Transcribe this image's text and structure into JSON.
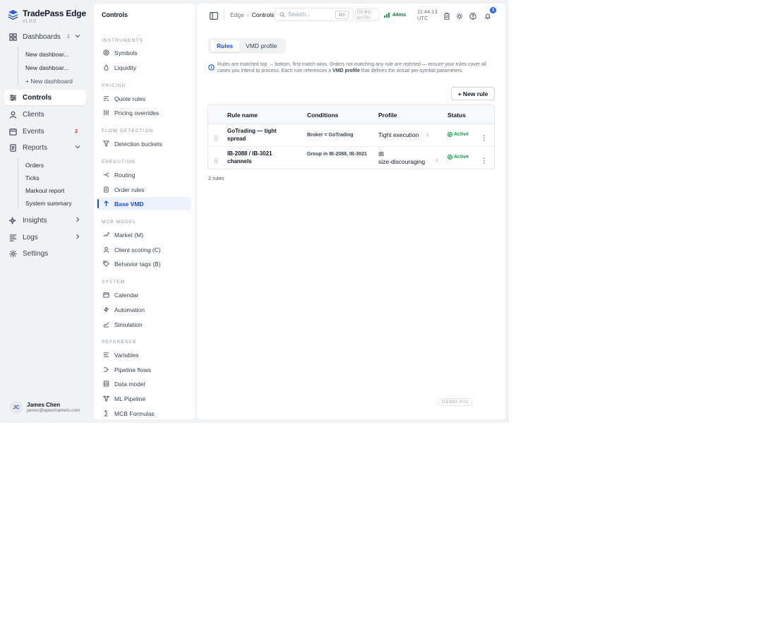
{
  "brand": {
    "name": "TradePass Edge",
    "version": "v1.0.0"
  },
  "sidebar": {
    "dashboards": {
      "label": "Dashboards",
      "count": "2"
    },
    "dashboard_items": [
      "New dashboar...",
      "New dashboar..."
    ],
    "new_dashboard": "+ New dashboard",
    "controls": "Controls",
    "clients": "Clients",
    "events": {
      "label": "Events",
      "count": "2"
    },
    "reports": "Reports",
    "report_items": [
      "Orders",
      "Ticks",
      "Markout report",
      "System summary"
    ],
    "insights": "Insights",
    "logs": "Logs",
    "settings": "Settings"
  },
  "user": {
    "initials": "JC",
    "name": "James Chen",
    "email": "james@apexmarkets.com"
  },
  "panel": {
    "title": "Controls",
    "groups": {
      "instruments": "INSTRUMENTS",
      "pricing": "PRICING",
      "flow_detection": "FLOW DETECTION",
      "execution": "EXECUTION",
      "mcb_model": "MCB MODEL",
      "system": "SYSTEM",
      "reference": "REFERENCE"
    },
    "items": {
      "symbols": "Symbols",
      "liquidity": "Liquidity",
      "quote_rules": "Quote rules",
      "pricing_overrides": "Pricing overrides",
      "detection_buckets": "Detection buckets",
      "routing": "Routing",
      "order_rules": "Order rules",
      "base_vmd": "Base VMD",
      "market": "Market (M)",
      "client_scoring": "Client scoring (C)",
      "behavior_tags": "Behavior tags (B)",
      "calendar": "Calendar",
      "automation": "Automation",
      "simulation": "Simulation",
      "variables": "Variables",
      "pipeline_flows": "Pipeline flows",
      "data_model": "Data model",
      "ml_pipeline": "ML Pipeline",
      "mcb_formulas": "MCB Formulas"
    }
  },
  "topbar": {
    "crumb_root": "Edge",
    "crumb_sep": "›",
    "crumb_current": "Controls",
    "search_placeholder": "Search...",
    "search_shortcut": "⌘K",
    "demo_line1": "DEMO ·",
    "demo_line2": "AUTO",
    "latency": "44ms",
    "time": "11:44:13",
    "timezone": "UTC",
    "notifications": "3"
  },
  "tabs": {
    "rules": "Rules",
    "vmd_profile": "VMD profile"
  },
  "info": {
    "part1": "Rules are matched top → bottom, first match wins. Orders not matching any rule are rejected — ensure your rules cover all cases you intend to process. Each rule references a ",
    "bold": "VMD profile",
    "part2": " that defines the actual per‑symbol parameters."
  },
  "new_rule_label": "+ New rule",
  "table": {
    "headers": {
      "name": "Rule name",
      "conditions": "Conditions",
      "profile": "Profile",
      "status": "Status"
    },
    "rows": [
      {
        "name": "GoTrading — tight spread",
        "conditions": "Broker = GoTrading",
        "profile": "Tight execution",
        "count": "· 2",
        "status": "Active"
      },
      {
        "name": "IB‑2088 / IB‑3021 channels",
        "conditions": "Group in IB‑2088, IB‑3021",
        "profile": "IB size‑discouraging",
        "count": "· 2",
        "status": "Active"
      }
    ]
  },
  "rules_count": "2 rules",
  "footer_badge": "DEMO Pro",
  "colors": {
    "accent": "#1d4ed8",
    "active_status": "#16a34a",
    "alert": "#dc2626",
    "app_bg": "#f1f2f4"
  }
}
